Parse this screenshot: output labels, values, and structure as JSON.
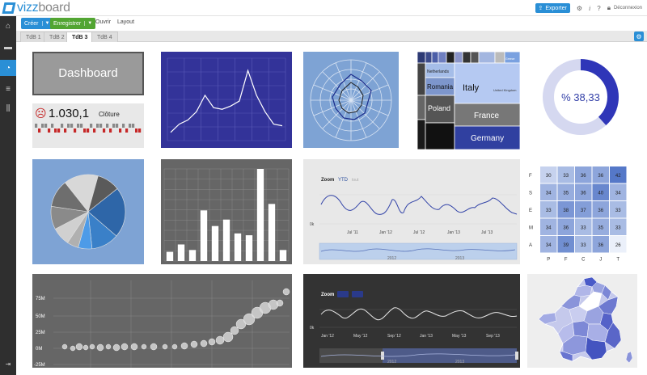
{
  "app": {
    "logo_prefix": "vizz",
    "logo_suffix": "board"
  },
  "menu": {
    "create": "Créer",
    "save": "Enregistrer",
    "open": "Ouvrir",
    "layout": "Layout"
  },
  "topright": {
    "export": "Exporter",
    "logout": "Déconnexion"
  },
  "tabs": [
    "TdB 1",
    "TdB 2",
    "TdB 3",
    "TdB 4"
  ],
  "active_tab": "TdB 3",
  "colors": {
    "accent": "#2a8fd6",
    "green": "#52a532",
    "sidebar": "#2f2f2f",
    "navy": "#333399",
    "steel": "#7ea3d4"
  },
  "dashboard_title": "Dashboard",
  "kpi": {
    "value": "1.030,1",
    "label": "Clôture",
    "icon": "sad-face-icon"
  },
  "donut": {
    "label": "% 38,33",
    "value_percent": 38.33
  },
  "treemap": {
    "labels": [
      "Netherlands",
      "Romania",
      "Italy",
      "United Kingdom",
      "Poland",
      "France",
      "Germany",
      "Greece"
    ]
  },
  "area_top": {
    "zoom_label": "Zoom",
    "ytd": "YTD",
    "full": "tout",
    "y_tick": "0k",
    "x_ticks": [
      "Jul '11",
      "Jan '12",
      "Jul '12",
      "Jan '13",
      "Jul '13"
    ],
    "nav_ticks": [
      "2012",
      "2013"
    ]
  },
  "area_bottom": {
    "zoom_label": "Zoom",
    "y_tick": "0k",
    "x_ticks": [
      "Jan '12",
      "May '12",
      "Sep '12",
      "Jan '13",
      "May '13",
      "Sep '13"
    ],
    "nav_ticks": [
      "2012",
      "2013"
    ]
  },
  "heatmap": {
    "row_labels": [
      "F",
      "S",
      "E",
      "M",
      "A"
    ],
    "col_labels": [
      "P",
      "F",
      "C",
      "J",
      "T"
    ],
    "values": [
      [
        30,
        33,
        36,
        36,
        42
      ],
      [
        34,
        35,
        36,
        40,
        34
      ],
      [
        33,
        38,
        37,
        36,
        33
      ],
      [
        34,
        36,
        33,
        35,
        33
      ],
      [
        34,
        39,
        33,
        36,
        26
      ]
    ]
  },
  "bubble": {
    "y_ticks": [
      "75M",
      "50M",
      "25M",
      "0M",
      "-25M"
    ]
  },
  "chart_data": [
    {
      "type": "line",
      "x": [
        1,
        2,
        3,
        4,
        5,
        6,
        7,
        8,
        9,
        10,
        11,
        12,
        13,
        14
      ],
      "values": [
        10,
        20,
        25,
        35,
        55,
        40,
        38,
        42,
        48,
        85,
        55,
        35,
        20,
        18
      ],
      "ylim": [
        0,
        100
      ]
    },
    {
      "type": "pie",
      "values": [
        22,
        12,
        6,
        5,
        8,
        10,
        12,
        15,
        10
      ],
      "colors": [
        "#2e66a8",
        "#3a80c8",
        "#4d9be8",
        "#b0b0b0",
        "#d0d0d0",
        "#8a8a8a",
        "#6e6e6e",
        "#d8d8d8",
        "#5a5a5a"
      ]
    },
    {
      "type": "bar",
      "values": [
        10,
        18,
        12,
        55,
        38,
        45,
        30,
        28,
        100,
        62,
        12
      ],
      "ylim": [
        0,
        100
      ]
    }
  ]
}
